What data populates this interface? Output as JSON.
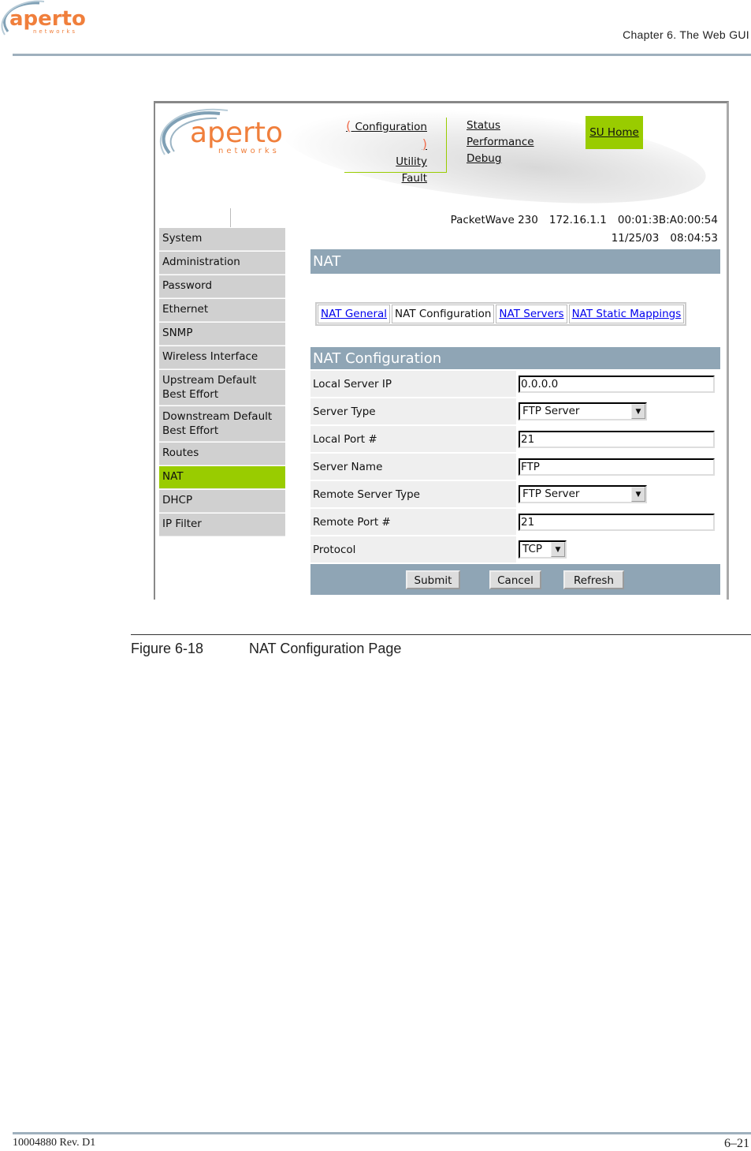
{
  "doc": {
    "header": "Chapter 6.  The Web GUI",
    "logo_text": "aperto",
    "logo_sub": "networks",
    "figure_label": "Figure 6-18",
    "figure_title": "NAT Configuration Page",
    "footer_left": "10004880 Rev. D1",
    "footer_right": "6–21"
  },
  "ui": {
    "logo_text": "aperto",
    "logo_sub": "networks",
    "nav_left": [
      "Configuration",
      "Utility",
      "Fault"
    ],
    "nav_right": [
      "Status",
      "Performance",
      "Debug"
    ],
    "su_home": "SU Home",
    "device": "PacketWave 230",
    "ip": "172.16.1.1",
    "mac": "00:01:3B:A0:00:54",
    "date": "11/25/03",
    "time": "08:04:53",
    "sidebar": [
      "System",
      "Administration",
      "Password",
      "Ethernet",
      "SNMP",
      "Wireless Interface",
      "Upstream Default Best Effort",
      "Downstream Default Best Effort",
      "Routes",
      "NAT",
      "DHCP",
      "IP Filter"
    ],
    "active_sidebar": "NAT",
    "section_title": "NAT",
    "tabs": [
      "NAT General",
      "NAT Configuration",
      "NAT Servers",
      "NAT Static Mappings"
    ],
    "active_tab": "NAT Configuration",
    "form_title": "NAT Configuration",
    "fields": [
      {
        "label": "Local Server IP",
        "value": "0.0.0.0",
        "type": "text"
      },
      {
        "label": "Server Type",
        "value": "FTP Server",
        "type": "select"
      },
      {
        "label": "Local Port #",
        "value": "21",
        "type": "text"
      },
      {
        "label": "Server Name",
        "value": "FTP",
        "type": "text"
      },
      {
        "label": "Remote Server Type",
        "value": "FTP Server",
        "type": "select"
      },
      {
        "label": "Remote Port #",
        "value": "21",
        "type": "text"
      },
      {
        "label": "Protocol",
        "value": "TCP",
        "type": "select"
      }
    ],
    "buttons": {
      "submit": "Submit",
      "cancel": "Cancel",
      "refresh": "Refresh"
    },
    "colors": {
      "accent": "#99cc00",
      "bar": "#8fa5b5",
      "logo": "#f07f3c"
    }
  }
}
